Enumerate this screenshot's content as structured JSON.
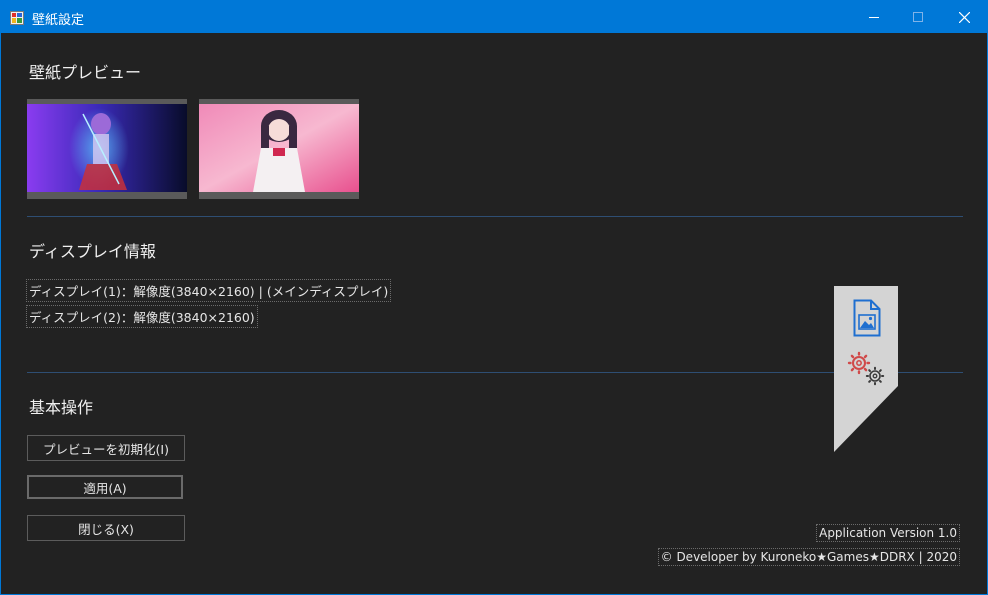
{
  "window": {
    "title": "壁紙設定",
    "icons": {
      "app": "wallpaper-app-icon",
      "minimize": "minimize-icon",
      "maximize": "maximize-icon",
      "close": "close-icon"
    }
  },
  "preview": {
    "title": "壁紙プレビュー",
    "thumbnails": [
      {
        "name": "display-1-wallpaper-thumbnail"
      },
      {
        "name": "display-2-wallpaper-thumbnail"
      }
    ]
  },
  "display_info": {
    "title": "ディスプレイ情報",
    "lines": [
      "ディスプレイ(1)：解像度(3840×2160) | (メインディスプレイ)",
      "ディスプレイ(2)：解像度(3840×2160)"
    ]
  },
  "operations": {
    "title": "基本操作",
    "buttons": {
      "reset_preview": "プレビューを初期化(I)",
      "apply": "適用(A)",
      "close": "閉じる(X)"
    }
  },
  "side_panel": {
    "icons": [
      "image-file-icon",
      "settings-gears-icon"
    ]
  },
  "footer": {
    "version": "Application Version 1.0",
    "copyright": "© Developer by Kuroneko★Games★DDRX | 2020"
  },
  "colors": {
    "titlebar": "#0078d7",
    "background": "#222222",
    "separator": "#2e4e73",
    "panel": "#d4d4d4"
  }
}
